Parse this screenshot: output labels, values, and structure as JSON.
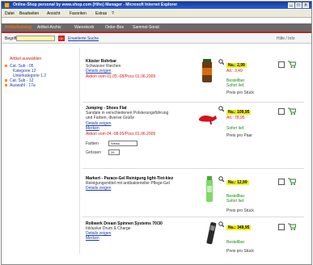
{
  "window": {
    "title": "Online-Shop personal by www.shop.com (Hiho) Manager - Microsoft Internet Explorer",
    "buttons": {
      "minimize": "_",
      "maximize": "□",
      "close": "x"
    }
  },
  "menubar": [
    "Datei",
    "Bearbeiten",
    "Ansicht",
    "Favoriten",
    "Extras",
    "?"
  ],
  "nav": {
    "items": [
      "Artikelkatalog",
      "Artikel-Archiv",
      "Warenkorb",
      "Order-Box",
      "Sammel-Sonst"
    ],
    "active_index": 0
  },
  "search": {
    "label": "Begriff",
    "value": "",
    "go_label": "OK",
    "advanced_link": "Erweiterte Suche",
    "right_label": "Hilfe / Info"
  },
  "sidebar": {
    "heading": "Artikel auswählen",
    "items": [
      {
        "label": "Cat. Sub - 05",
        "level": 0
      },
      {
        "label": "Kategorie 12",
        "level": 1
      },
      {
        "label": "Unterkategorie 1.2",
        "level": 1
      },
      {
        "label": "Cat. Sub - 12",
        "level": 0
      },
      {
        "label": "Auswahl - 17a",
        "level": 0
      }
    ]
  },
  "products": [
    {
      "name": "Klüster Rohrbar",
      "desc": [
        "Schwarzer Riechen"
      ],
      "links": [
        "Details zeigen"
      ],
      "note": "Aktion vom 01.05.-08/Pocs 01.06.2009",
      "price": "Nu.: 2,99",
      "save": "Alt.: 3,49",
      "stock": [
        "Bestellbar",
        "Sofort lief."
      ],
      "per": "Preis pro Stück",
      "has_qty": false,
      "image": "bottle"
    },
    {
      "name": "Jumping - Shoes Flat",
      "desc": [
        "Sandale in verschiedenen Polsterungsführung",
        "und Farben, diverse Grüße"
      ],
      "links": [
        "Details zeigen",
        "Merken"
      ],
      "note": "Aktion vom 04.-08.05/Pocs 01.06.2009",
      "price": "Nu.: 109,95",
      "save": "Alt.: 78,95",
      "stock": [
        "Sofort lief."
      ],
      "per": "Preis pro Paar",
      "has_qty": true,
      "qty": {
        "color_label": "Farben",
        "color_value": "Weiss",
        "size_label": "Grössen",
        "size_value": "39"
      },
      "image": "shoe"
    },
    {
      "name": "Markert - Parace-Gel Reinigung light-Tint-kiez",
      "desc": [
        "Reinigungsmittel mit antibakterieller Pflege-Gel"
      ],
      "links": [
        "Details zeigen"
      ],
      "note": "",
      "price": "Nu.: 12,99",
      "save": "",
      "stock": [
        "Bestellbar",
        "Sofort lief."
      ],
      "per": "Preis pro Stück",
      "has_qty": false,
      "image": "tube"
    },
    {
      "name": "Rollwerk Dream Spinnen Systems 70/30",
      "desc": [
        "Inklusive Drum & Charge"
      ],
      "links": [
        "Details zeigen",
        "Merken"
      ],
      "note": "",
      "price": "Nu.: 349,95",
      "save": "",
      "stock": [
        "Bestellbar"
      ],
      "per": "Preis pro Stück",
      "has_qty": false,
      "image": "phone"
    }
  ]
}
